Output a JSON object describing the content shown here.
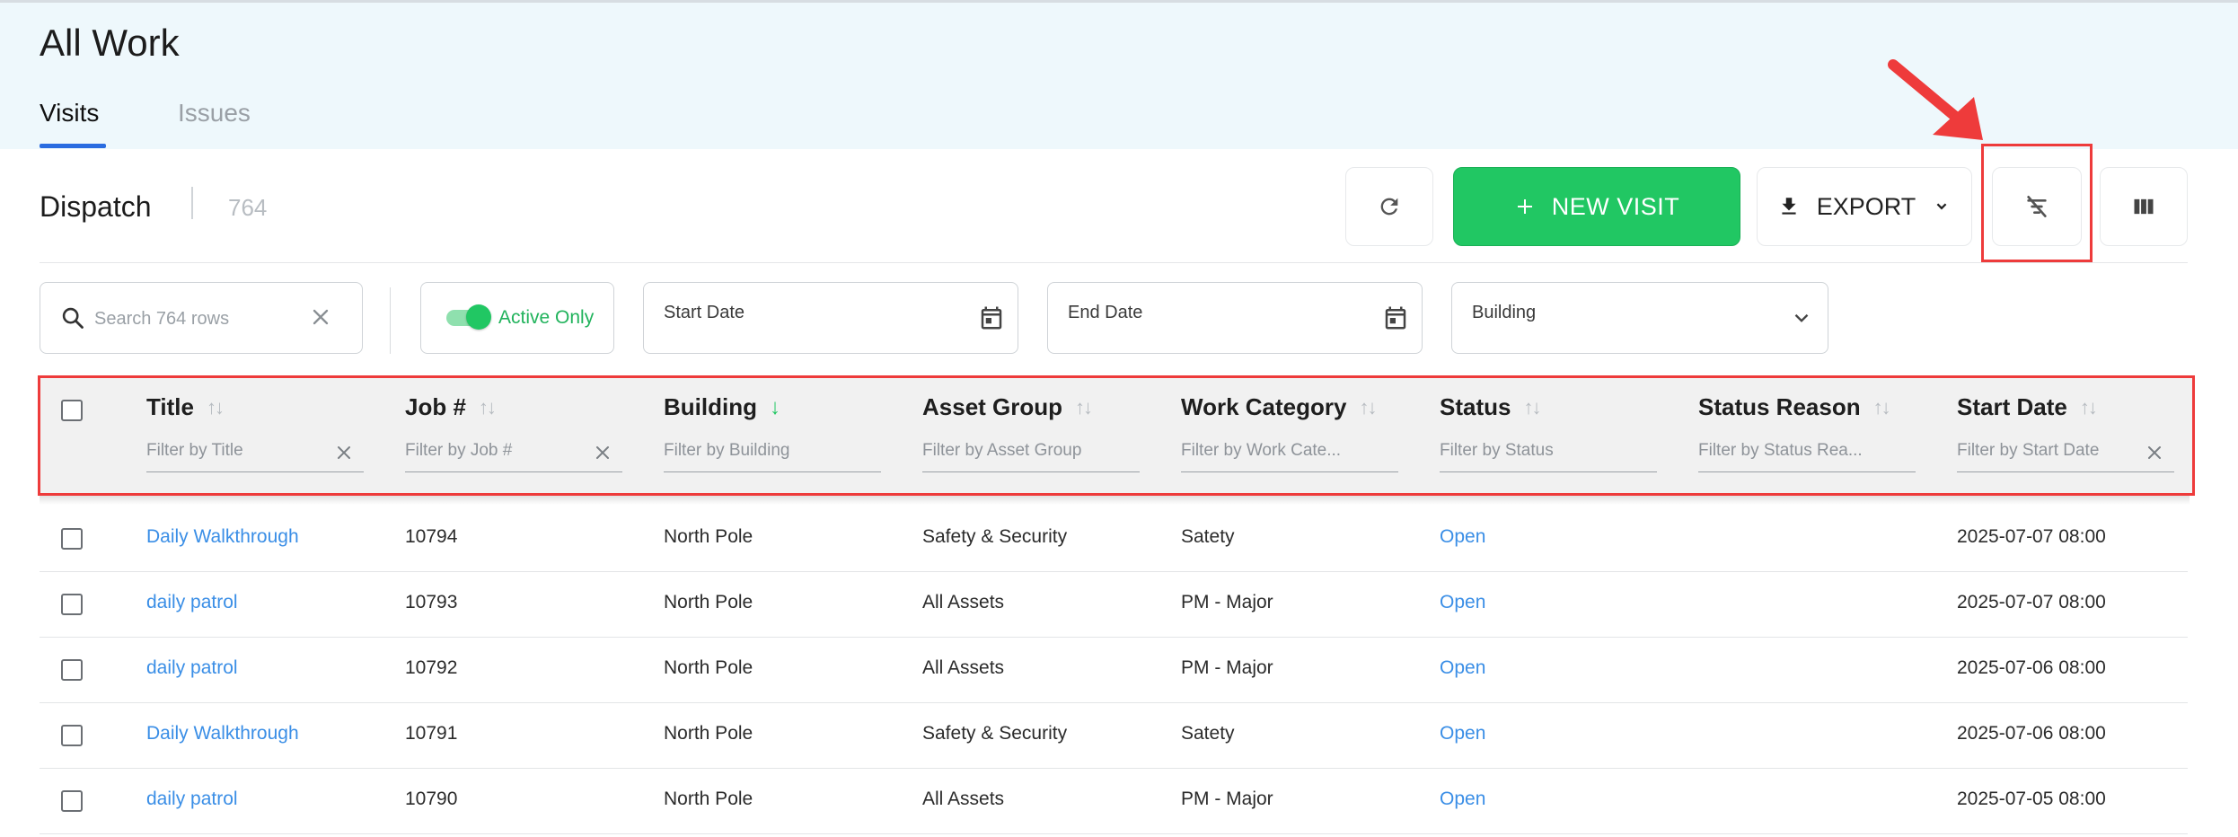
{
  "page": {
    "title": "All Work"
  },
  "tabs": [
    {
      "label": "Visits",
      "active": true
    },
    {
      "label": "Issues",
      "active": false
    }
  ],
  "toolbar": {
    "section_label": "Dispatch",
    "count": "764",
    "new_visit_label": "NEW VISIT",
    "export_label": "EXPORT"
  },
  "filters": {
    "search_placeholder": "Search 764 rows",
    "active_only_label": "Active Only",
    "active_only_on": true,
    "start_date_label": "Start Date",
    "end_date_label": "End Date",
    "building_label": "Building"
  },
  "table": {
    "columns": [
      {
        "label": "Title",
        "filter_placeholder": "Filter by Title",
        "sort": "none"
      },
      {
        "label": "Job #",
        "filter_placeholder": "Filter by Job #",
        "sort": "none"
      },
      {
        "label": "Building",
        "filter_placeholder": "Filter by Building",
        "sort": "desc"
      },
      {
        "label": "Asset Group",
        "filter_placeholder": "Filter by Asset Group",
        "sort": "none"
      },
      {
        "label": "Work Category",
        "filter_placeholder": "Filter by Work Cate...",
        "sort": "none"
      },
      {
        "label": "Status",
        "filter_placeholder": "Filter by Status",
        "sort": "none"
      },
      {
        "label": "Status Reason",
        "filter_placeholder": "Filter by Status Rea...",
        "sort": "none"
      },
      {
        "label": "Start Date",
        "filter_placeholder": "Filter by Start Date",
        "sort": "none"
      }
    ],
    "rows": [
      {
        "title": "Daily Walkthrough",
        "job": "10794",
        "building": "North Pole",
        "asset_group": "Safety & Security",
        "work_category": "Satety",
        "status": "Open",
        "status_reason": "",
        "start_date": "2025-07-07 08:00"
      },
      {
        "title": "daily patrol",
        "job": "10793",
        "building": "North Pole",
        "asset_group": "All Assets",
        "work_category": "PM - Major",
        "status": "Open",
        "status_reason": "",
        "start_date": "2025-07-07 08:00"
      },
      {
        "title": "daily patrol",
        "job": "10792",
        "building": "North Pole",
        "asset_group": "All Assets",
        "work_category": "PM - Major",
        "status": "Open",
        "status_reason": "",
        "start_date": "2025-07-06 08:00"
      },
      {
        "title": "Daily Walkthrough",
        "job": "10791",
        "building": "North Pole",
        "asset_group": "Safety & Security",
        "work_category": "Satety",
        "status": "Open",
        "status_reason": "",
        "start_date": "2025-07-06 08:00"
      },
      {
        "title": "daily patrol",
        "job": "10790",
        "building": "North Pole",
        "asset_group": "All Assets",
        "work_category": "PM - Major",
        "status": "Open",
        "status_reason": "",
        "start_date": "2025-07-05 08:00"
      }
    ]
  },
  "colors": {
    "accent_green": "#21c763",
    "link_blue": "#3a8ee6",
    "annotation_red": "#ee3b3b",
    "header_band": "#eef8fc"
  },
  "icons": [
    "refresh-icon",
    "plus-icon",
    "download-icon",
    "chevron-down-icon",
    "clear-filters-icon",
    "columns-icon",
    "search-icon",
    "close-icon",
    "calendar-icon",
    "sort-icon",
    "arrow-down-icon"
  ]
}
